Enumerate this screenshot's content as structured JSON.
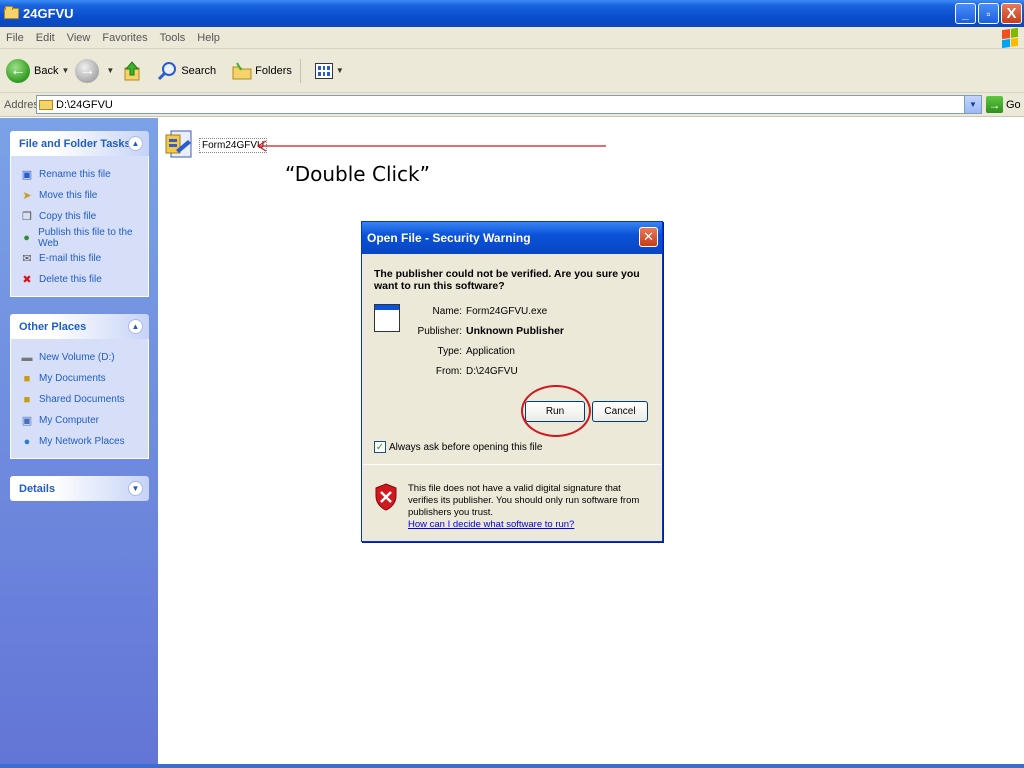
{
  "window": {
    "title": "24GFVU",
    "buttons": {
      "minimize": "_",
      "maximize": "▫",
      "close": "X"
    }
  },
  "menu": [
    "File",
    "Edit",
    "View",
    "Favorites",
    "Tools",
    "Help"
  ],
  "toolbar": {
    "back_label": "Back",
    "search_label": "Search",
    "folders_label": "Folders"
  },
  "address": {
    "label": "Address",
    "value": "D:\\24GFVU",
    "go_label": "Go"
  },
  "file_tasks": {
    "title": "File and Folder Tasks",
    "items": [
      {
        "label": "Rename this file",
        "icon": "rename-icon"
      },
      {
        "label": "Move this file",
        "icon": "move-icon"
      },
      {
        "label": "Copy this file",
        "icon": "copy-icon"
      },
      {
        "label": "Publish this file to the Web",
        "icon": "globe-icon"
      },
      {
        "label": "E-mail this file",
        "icon": "email-icon"
      },
      {
        "label": "Delete this file",
        "icon": "delete-icon"
      }
    ]
  },
  "other_places": {
    "title": "Other Places",
    "items": [
      {
        "label": "New Volume (D:)",
        "icon": "drive-icon"
      },
      {
        "label": "My Documents",
        "icon": "documents-folder-icon"
      },
      {
        "label": "Shared Documents",
        "icon": "shared-folder-icon"
      },
      {
        "label": "My Computer",
        "icon": "computer-icon"
      },
      {
        "label": "My Network Places",
        "icon": "network-icon"
      }
    ]
  },
  "details": {
    "title": "Details"
  },
  "file": {
    "name": "Form24GFVU",
    "icon": "installer-icon"
  },
  "annotation": {
    "text": "“Double Click”",
    "color": "#d0181e"
  },
  "dialog": {
    "title": "Open File - Security Warning",
    "question": "The publisher could not be verified.  Are you sure you want to run this software?",
    "fields": [
      {
        "key": "Name:",
        "value": "Form24GFVU.exe",
        "bold": false
      },
      {
        "key": "Publisher:",
        "value": "Unknown Publisher",
        "bold": true
      },
      {
        "key": "Type:",
        "value": "Application",
        "bold": false
      },
      {
        "key": "From:",
        "value": "D:\\24GFVU",
        "bold": false
      }
    ],
    "run_label": "Run",
    "cancel_label": "Cancel",
    "checkbox_label": "Always ask before opening this file",
    "checkbox_checked": true,
    "warning_text": "This file does not have a valid digital signature that verifies its publisher.  You should only run software from publishers you trust.",
    "warning_link": "How can I decide what software to run?"
  },
  "colors": {
    "titlebar": "#0a52d8",
    "taskpane": "#6f8ee0",
    "link": "#215dc6",
    "highlight": "#d0181e"
  }
}
